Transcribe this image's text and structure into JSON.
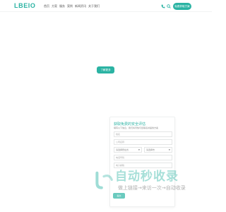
{
  "header": {
    "logo": "LBEIO",
    "nav": [
      "首页",
      "方案",
      "服务",
      "案例",
      "新闻资讯",
      "关于我们"
    ],
    "cta_label": "免费获取方案",
    "icons": [
      "phone-icon",
      "search-icon"
    ]
  },
  "hero": {
    "button_label": "了解更多"
  },
  "form": {
    "title": "获取免费的安全评估",
    "subtitle": "填写以下信息，我们将尽快与您联系并提供方案",
    "fields": {
      "name_placeholder": "姓名",
      "company_placeholder": "公司名称",
      "province_select": "请选择所在省",
      "city_select": "请选择市",
      "phone_placeholder": "电话号码",
      "email_placeholder": "电子邮箱"
    },
    "submit_label": "提交"
  },
  "watermark": {
    "title": "自动秒收录",
    "subtitle": "做上链接→来访一次→自动收录"
  },
  "colors": {
    "accent": "#2bb3a3",
    "text": "#555555",
    "border": "#e4e6e6"
  }
}
